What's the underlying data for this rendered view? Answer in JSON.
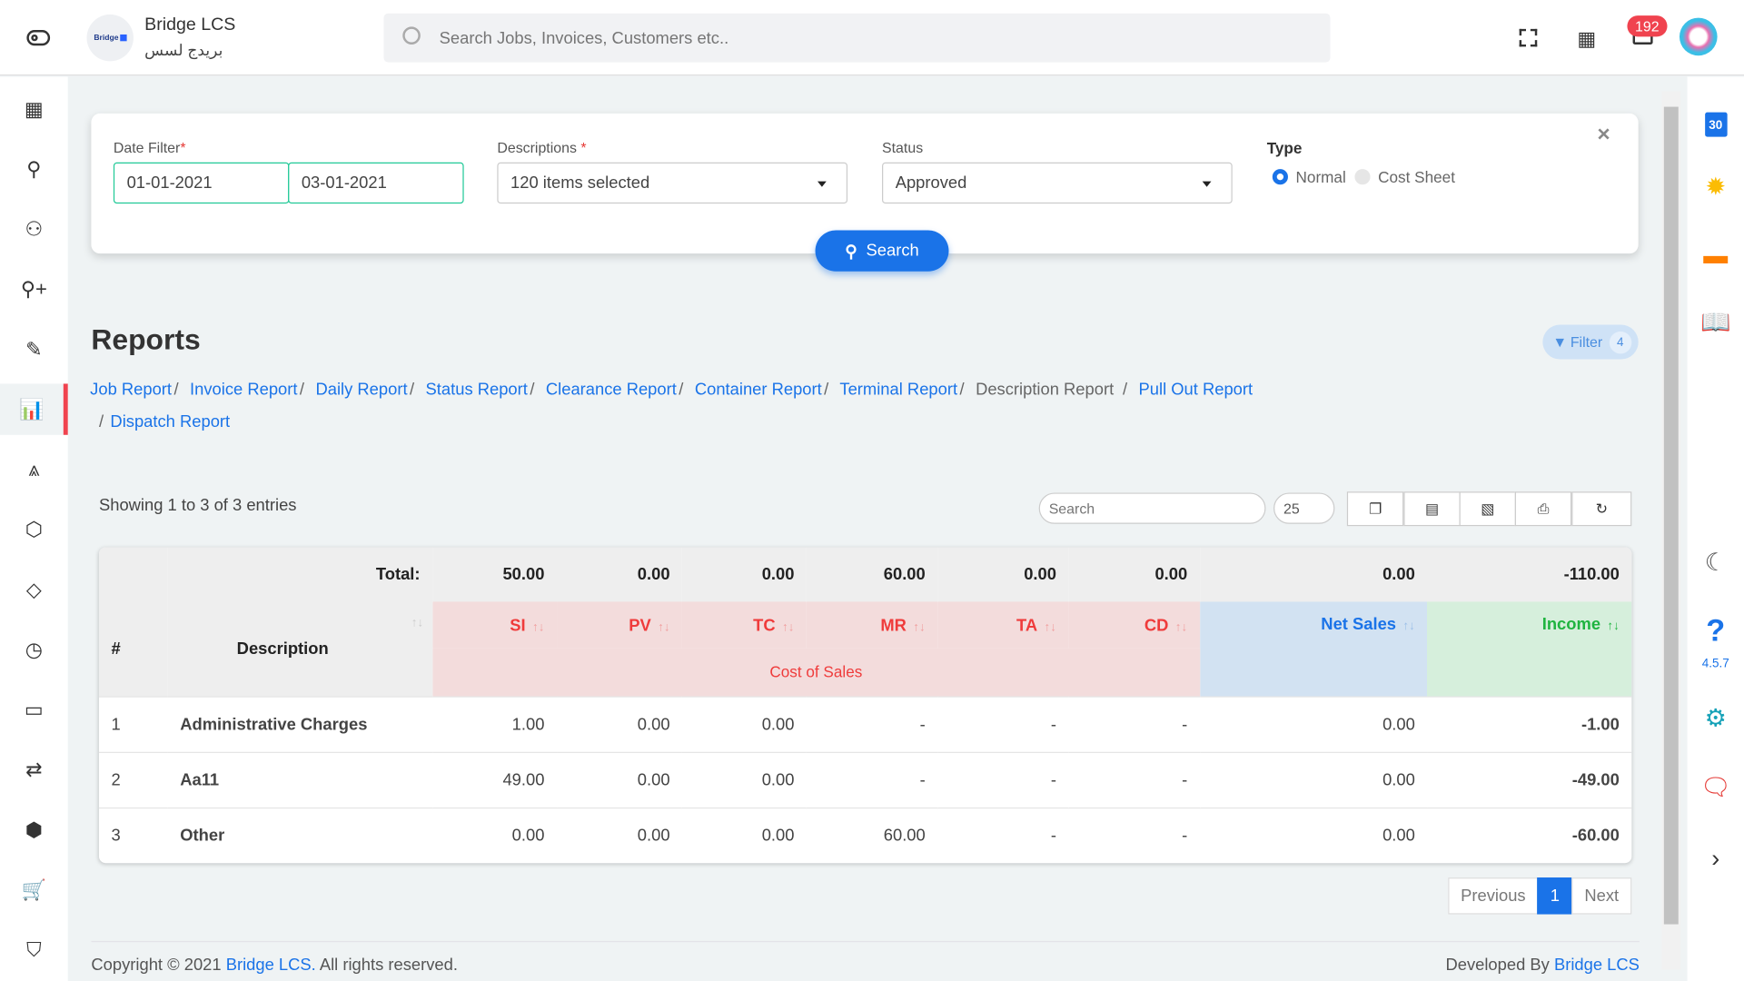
{
  "header": {
    "brand": "Bridge LCS",
    "brand_arabic": "بريدج لسس",
    "logo_text": "Bridge",
    "search_placeholder": "Search Jobs, Invoices, Customers etc..",
    "notification_count": "192"
  },
  "sidebar": {
    "items": [
      {
        "icon": "dashboard-icon"
      },
      {
        "icon": "user-icon"
      },
      {
        "icon": "users-icon"
      },
      {
        "icon": "user-plus-icon"
      },
      {
        "icon": "edit-icon"
      },
      {
        "icon": "chart-icon",
        "active": true
      },
      {
        "icon": "navigation-icon"
      },
      {
        "icon": "box-icon"
      },
      {
        "icon": "tag-icon"
      },
      {
        "icon": "clock-icon"
      },
      {
        "icon": "credit-card-icon"
      },
      {
        "icon": "repeat-icon"
      },
      {
        "icon": "codepen-icon"
      },
      {
        "icon": "cart-icon"
      },
      {
        "icon": "shield-icon"
      }
    ]
  },
  "rightbar": {
    "calendar_day": "30",
    "version": "4.5.7"
  },
  "filter": {
    "date_label": "Date Filter",
    "date_from": "01-01-2021",
    "date_to": "03-01-2021",
    "desc_label": "Descriptions",
    "desc_value": "120 items selected",
    "status_label": "Status",
    "status_value": "Approved",
    "type_label": "Type",
    "type_options": [
      "Normal",
      "Cost Sheet"
    ],
    "type_selected": "Normal",
    "search_button": "Search"
  },
  "page": {
    "title": "Reports",
    "filter_button": "Filter",
    "filter_count": "4",
    "breadcrumbs": [
      {
        "label": "Job Report",
        "link": true
      },
      {
        "label": "Invoice Report",
        "link": true
      },
      {
        "label": "Daily Report",
        "link": true
      },
      {
        "label": "Status Report",
        "link": true
      },
      {
        "label": "Clearance Report",
        "link": true
      },
      {
        "label": "Container Report",
        "link": true
      },
      {
        "label": "Terminal Report",
        "link": true
      },
      {
        "label": "Description Report",
        "link": false
      },
      {
        "label": "Pull Out Report",
        "link": true
      },
      {
        "label": "Dispatch Report",
        "link": true
      }
    ]
  },
  "table": {
    "info": "Showing 1 to 3 of 3 entries",
    "search_placeholder": "Search",
    "page_size": "25",
    "total_label": "Total:",
    "totals": [
      "50.00",
      "0.00",
      "0.00",
      "60.00",
      "0.00",
      "0.00",
      "0.00",
      "-110.00"
    ],
    "columns": {
      "num": "#",
      "desc": "Description",
      "si": "SI",
      "pv": "PV",
      "tc": "TC",
      "mr": "MR",
      "ta": "TA",
      "cd": "CD",
      "net": "Net Sales",
      "income": "Income",
      "group": "Cost of Sales"
    },
    "rows": [
      {
        "n": "1",
        "desc": "Administrative Charges",
        "vals": [
          "1.00",
          "0.00",
          "0.00",
          "-",
          "-",
          "-",
          "0.00",
          "-1.00"
        ]
      },
      {
        "n": "2",
        "desc": "Aa11",
        "vals": [
          "49.00",
          "0.00",
          "0.00",
          "-",
          "-",
          "-",
          "0.00",
          "-49.00"
        ]
      },
      {
        "n": "3",
        "desc": "Other",
        "vals": [
          "0.00",
          "0.00",
          "0.00",
          "60.00",
          "-",
          "-",
          "0.00",
          "-60.00"
        ]
      }
    ],
    "pagination": {
      "prev": "Previous",
      "current": "1",
      "next": "Next"
    }
  },
  "footer": {
    "copyright_prefix": "Copyright © 2021",
    "copyright_link": "Bridge LCS.",
    "copyright_suffix": "All rights reserved.",
    "developed_prefix": "Developed By",
    "developed_link": "Bridge LCS"
  },
  "colors": {
    "accent": "#1a73e8",
    "danger": "#f0434f",
    "cost_bg": "#f3dcdc",
    "net_bg": "#d2e2f2",
    "income_bg": "#d6efdc"
  }
}
